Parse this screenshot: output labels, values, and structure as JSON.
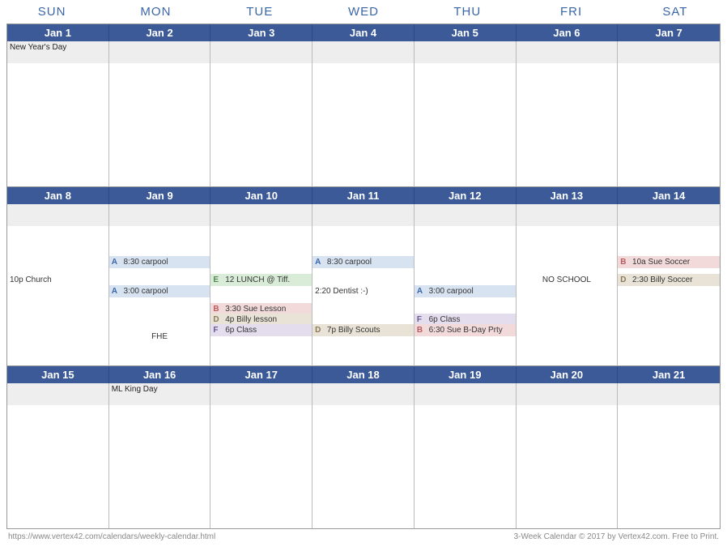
{
  "daysOfWeek": [
    "SUN",
    "MON",
    "TUE",
    "WED",
    "THU",
    "FRI",
    "SAT"
  ],
  "weeks": [
    {
      "dates": [
        "Jan 1",
        "Jan 2",
        "Jan 3",
        "Jan 4",
        "Jan 5",
        "Jan 6",
        "Jan 7"
      ],
      "headers": [
        "New Year's Day",
        "",
        "",
        "",
        "",
        "",
        ""
      ]
    },
    {
      "dates": [
        "Jan 8",
        "Jan 9",
        "Jan 10",
        "Jan 11",
        "Jan 12",
        "Jan 13",
        "Jan 14"
      ],
      "headers": [
        "",
        "",
        "",
        "",
        "",
        "",
        ""
      ]
    },
    {
      "dates": [
        "Jan 15",
        "Jan 16",
        "Jan 17",
        "Jan 18",
        "Jan 19",
        "Jan 20",
        "Jan 21"
      ],
      "headers": [
        "",
        "ML King Day",
        "",
        "",
        "",
        "",
        ""
      ]
    }
  ],
  "events": {
    "w1": {
      "sun": [
        {
          "t": 58,
          "txt": "10p  Church"
        }
      ],
      "mon": [
        {
          "t": 36,
          "code": "A",
          "txt": "8:30 carpool",
          "cls": "bg-A"
        },
        {
          "t": 72,
          "code": "A",
          "txt": "3:00 carpool",
          "cls": "bg-A"
        },
        {
          "t": 128,
          "txt": "FHE",
          "center": true
        }
      ],
      "tue": [
        {
          "t": 58,
          "code": "E",
          "txt": "12 LUNCH @ Tiff.",
          "cls": "bg-E"
        },
        {
          "t": 94,
          "code": "B",
          "txt": "3:30 Sue Lesson",
          "cls": "bg-B"
        },
        {
          "t": 107,
          "code": "D",
          "txt": "4p Billy lesson",
          "cls": "bg-D"
        },
        {
          "t": 120,
          "code": "F",
          "txt": "6p Class",
          "cls": "bg-F"
        }
      ],
      "wed": [
        {
          "t": 36,
          "code": "A",
          "txt": "8:30 carpool",
          "cls": "bg-A"
        },
        {
          "t": 72,
          "txt": "2:20  Dentist :-)"
        },
        {
          "t": 120,
          "code": "D",
          "txt": "7p Billy Scouts",
          "cls": "bg-D"
        }
      ],
      "thu": [
        {
          "t": 72,
          "code": "A",
          "txt": "3:00 carpool",
          "cls": "bg-A"
        },
        {
          "t": 107,
          "code": "F",
          "txt": "6p Class",
          "cls": "bg-F"
        },
        {
          "t": 120,
          "code": "B",
          "txt": "6:30 Sue B-Day Prty",
          "cls": "bg-B"
        }
      ],
      "fri": [
        {
          "t": 58,
          "txt": "NO SCHOOL",
          "center": true
        }
      ],
      "sat": [
        {
          "t": 36,
          "code": "B",
          "txt": "10a Sue Soccer",
          "cls": "bg-B"
        },
        {
          "t": 58,
          "code": "D",
          "txt": "2:30 Billy Soccer",
          "cls": "bg-D"
        }
      ]
    }
  },
  "footer": {
    "left": "https://www.vertex42.com/calendars/weekly-calendar.html",
    "right": "3-Week Calendar © 2017 by Vertex42.com. Free to Print."
  }
}
